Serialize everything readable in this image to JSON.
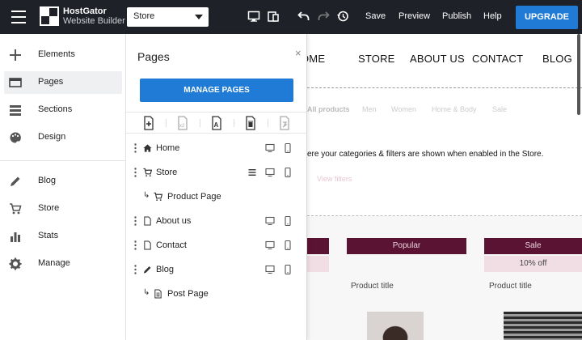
{
  "topbar": {
    "logo_line1": "HostGator",
    "logo_line2": "Website Builder",
    "page_select_value": "Store",
    "save_label": "Save",
    "preview_label": "Preview",
    "publish_label": "Publish",
    "help_label": "Help",
    "upgrade_label": "UPGRADE",
    "icons": [
      "desktop-icon",
      "mobile-icon",
      "undo-icon",
      "redo-icon",
      "history-icon"
    ]
  },
  "sidebar": {
    "items": [
      {
        "label": "Elements",
        "icon": "plus-icon"
      },
      {
        "label": "Pages",
        "icon": "pages-icon",
        "active": true
      },
      {
        "label": "Sections",
        "icon": "sections-icon"
      },
      {
        "label": "Design",
        "icon": "palette-icon"
      },
      {
        "label": "Blog",
        "icon": "pencil-icon"
      },
      {
        "label": "Store",
        "icon": "cart-icon"
      },
      {
        "label": "Stats",
        "icon": "bar-chart-icon"
      },
      {
        "label": "Manage",
        "icon": "gear-icon"
      }
    ]
  },
  "panel": {
    "title": "Pages",
    "close": "×",
    "manage_button": "MANAGE PAGES",
    "tools": [
      "add-page-icon",
      "duplicate-icon",
      "rename-icon",
      "delete-icon",
      "link-icon"
    ],
    "pages": [
      {
        "label": "Home",
        "icon": "home-icon"
      },
      {
        "label": "Store",
        "icon": "cart-icon"
      },
      {
        "label": "Product Page",
        "icon": "cart-icon",
        "child": true
      },
      {
        "label": "About us",
        "icon": "page-icon"
      },
      {
        "label": "Contact",
        "icon": "page-icon"
      },
      {
        "label": "Blog",
        "icon": "pencil-icon"
      },
      {
        "label": "Post Page",
        "icon": "post-icon",
        "child": true
      }
    ]
  },
  "canvas": {
    "nav": [
      "OME",
      "STORE",
      "ABOUT US",
      "CONTACT",
      "BLOG"
    ],
    "categories": [
      "All products",
      "Men",
      "Women",
      "Home & Body",
      "Sale"
    ],
    "info_text": "ere your categories & filters are shown when enabled in the Store.",
    "view_filters": "View filters",
    "badges": [
      {
        "label": "Popular"
      },
      {
        "label": "Sale",
        "sub": "10% off"
      }
    ],
    "product_titles": [
      "Product title",
      "Product title"
    ],
    "colors": {
      "accent": "#1f7bd5",
      "badge": "#5b1333",
      "badge_sub": "#f1dde4",
      "topbar": "#1f2128"
    }
  }
}
